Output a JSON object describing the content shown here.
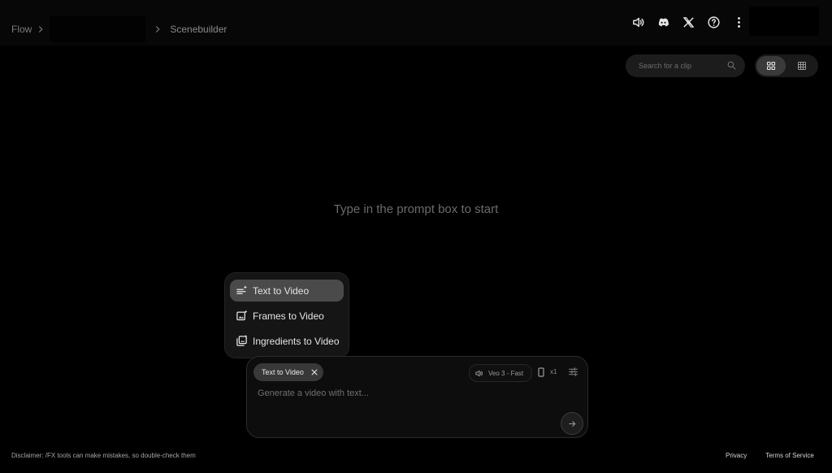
{
  "breadcrumb": {
    "root": "Flow",
    "current": "Scenebuilder"
  },
  "header_icons": [
    "volume-icon",
    "discord-icon",
    "x-icon",
    "help-icon",
    "more-vert-icon"
  ],
  "search": {
    "placeholder": "Search for a clip",
    "value": ""
  },
  "empty_state": "Type in the prompt box to start",
  "mode_menu": {
    "items": [
      {
        "label": "Text to Video",
        "icon": "text-sparkle-icon",
        "selected": true
      },
      {
        "label": "Frames to Video",
        "icon": "image-sparkle-icon",
        "selected": false
      },
      {
        "label": "Ingredients to Video",
        "icon": "layers-sparkle-icon",
        "selected": false
      }
    ]
  },
  "prompt": {
    "mode_chip": "Text to Video",
    "model": "Veo 3 - Fast",
    "count": "x1",
    "placeholder": "Generate a video with text...",
    "value": ""
  },
  "footer": {
    "disclaimer": "Disclaimer: /FX tools can make mistakes, so double-check them",
    "privacy": "Privacy",
    "terms": "Terms of Service"
  },
  "colors": {
    "background": "#000000",
    "selected_item": "#4a4a4a",
    "chip": "#383838"
  }
}
